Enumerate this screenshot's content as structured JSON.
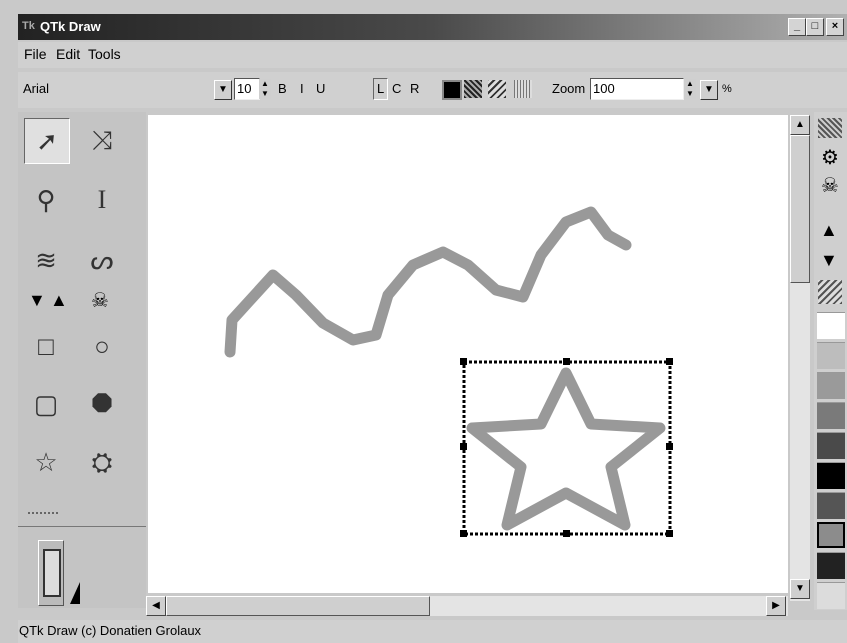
{
  "window": {
    "title": "QTk Draw",
    "icon_label": "Tk",
    "minimize": "_",
    "maximize": "□",
    "close": "×"
  },
  "menu": [
    "File",
    "Edit",
    "Tools"
  ],
  "toolbar": {
    "font": "Arial",
    "size": "10",
    "bold": "B",
    "italic": "I",
    "underline": "U",
    "align_left": "L",
    "align_center": "C",
    "align_right": "R",
    "zoom_label": "Zoom",
    "zoom_value": "100",
    "percent": "%"
  },
  "tools": [
    {
      "name": "select-arrow-icon",
      "glyph": "➚"
    },
    {
      "name": "node-edit-icon",
      "glyph": "⤨"
    },
    {
      "name": "magnifier-icon",
      "glyph": "⚲"
    },
    {
      "name": "text-cursor-icon",
      "glyph": "I"
    },
    {
      "name": "freehand-icon",
      "glyph": "≋"
    },
    {
      "name": "curve-icon",
      "glyph": "ᔕ"
    },
    {
      "name": "rectangle-icon",
      "glyph": "□"
    },
    {
      "name": "circle-icon",
      "glyph": "○"
    },
    {
      "name": "rounded-rect-icon",
      "glyph": "▢"
    },
    {
      "name": "octagon-icon",
      "glyph": "⯃"
    },
    {
      "name": "star-icon",
      "glyph": "☆"
    },
    {
      "name": "image-tool-icon",
      "glyph": "⛭"
    }
  ],
  "palette": [
    "#ffffff",
    "#bdbdbd",
    "#9a9a9a",
    "#7a7a7a",
    "#4a4a4a",
    "#000000",
    "#555555",
    "#8c8c8c",
    "#222222",
    "#dcdcdc"
  ],
  "status": "QTk Draw (c) Donatien Grolaux"
}
